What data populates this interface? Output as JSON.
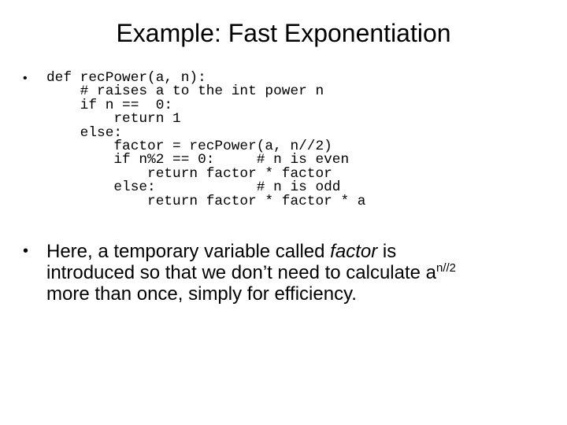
{
  "slide": {
    "title": "Example: Fast Exponentiation",
    "code_bullet": "•",
    "code_lines": [
      "def recPower(a, n):",
      "    # raises a to the int power n",
      "    if n ==  0:",
      "        return 1",
      "    else:",
      "        factor = recPower(a, n//2)",
      "        if n%2 == 0:     # n is even",
      "            return factor * factor",
      "        else:            # n is odd",
      "            return factor * factor * a"
    ],
    "explanation": {
      "bullet": "•",
      "line1_before": "Here, a temporary variable called ",
      "line1_emphasis": "factor",
      "line1_after": " is",
      "line2_before": "introduced so that we don’t need to calculate a",
      "line2_superscript": "n//2",
      "line3": "more than once, simply for efficiency."
    }
  }
}
